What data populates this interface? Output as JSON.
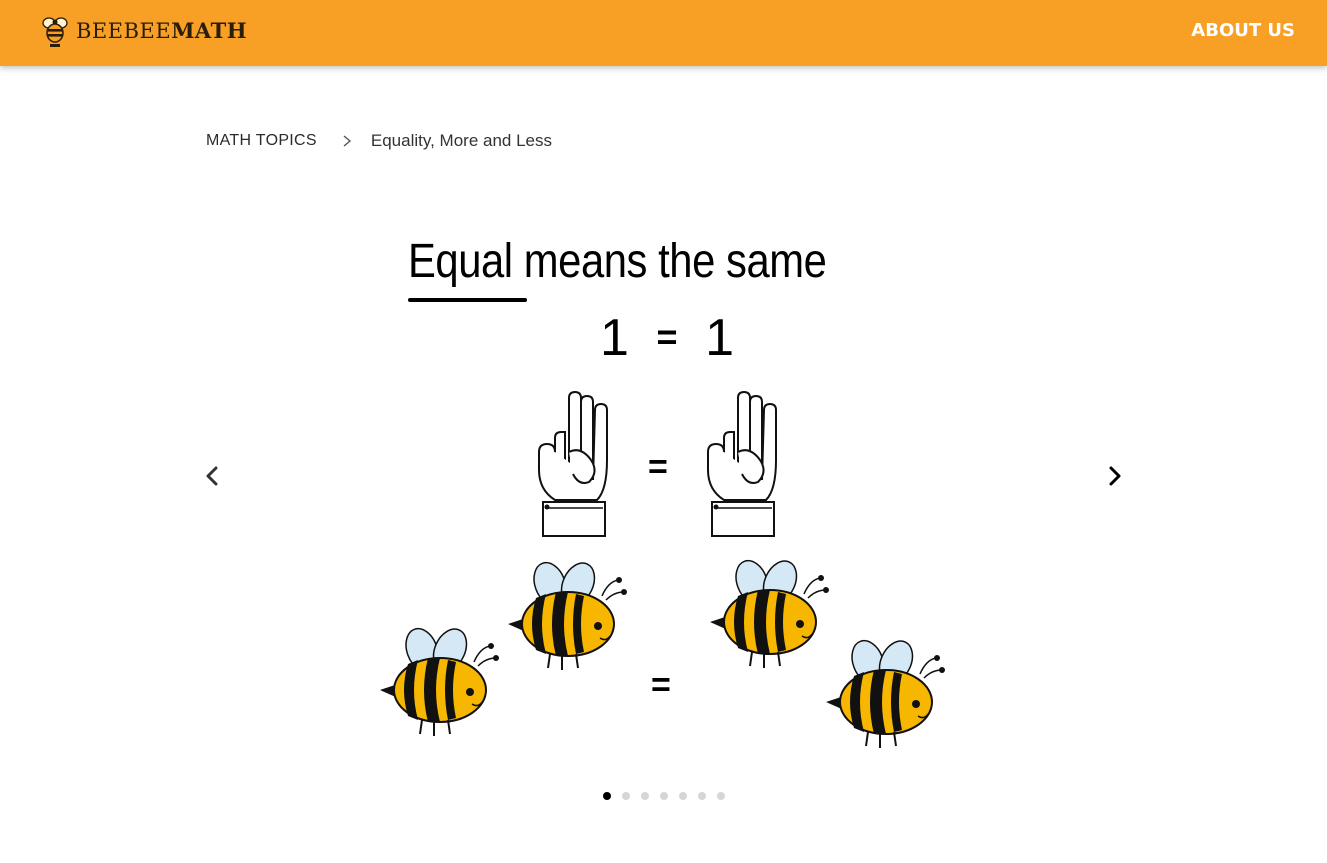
{
  "header": {
    "logo_text_light": "BEEBEE",
    "logo_text_bold": "MATH",
    "nav_about": "ABOUT US"
  },
  "breadcrumb": {
    "parent": "MATH TOPICS",
    "current": "Equality, More and Less"
  },
  "slide": {
    "title_underlined": "Equal",
    "title_rest": " means the same",
    "left_number": "1",
    "equals": "=",
    "right_number": "1",
    "hands_equals": "=",
    "bees_equals": "="
  },
  "carousel": {
    "slide_count": 7,
    "active_index": 0
  },
  "colors": {
    "header_bg": "#f8a025",
    "bee_yellow": "#f7b600",
    "wing_blue": "#d5e8f5"
  },
  "icons": {
    "logo": "bee-logo-icon",
    "breadcrumb_separator": "chevron-right-icon",
    "prev": "chevron-left-icon",
    "next": "chevron-right-icon"
  }
}
